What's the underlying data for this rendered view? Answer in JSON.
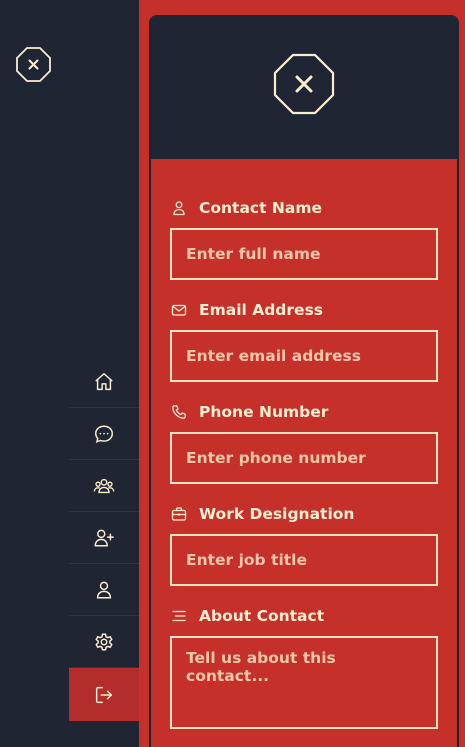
{
  "sidebar": {
    "logo_icon": "close-octagon-icon",
    "items": [
      {
        "name": "home",
        "icon": "home-icon"
      },
      {
        "name": "messages",
        "icon": "chat-bubble-icon"
      },
      {
        "name": "groups",
        "icon": "users-icon"
      },
      {
        "name": "add-user",
        "icon": "user-plus-icon"
      },
      {
        "name": "profile",
        "icon": "user-icon"
      },
      {
        "name": "settings",
        "icon": "gear-icon"
      },
      {
        "name": "logout",
        "icon": "logout-icon",
        "active": true
      }
    ]
  },
  "panel": {
    "close_icon": "close-octagon-icon"
  },
  "form": {
    "contact_name": {
      "label": "Contact Name",
      "placeholder": "Enter full name",
      "icon": "user-icon"
    },
    "email": {
      "label": "Email Address",
      "placeholder": "Enter email address",
      "icon": "mail-icon"
    },
    "phone": {
      "label": "Phone Number",
      "placeholder": "Enter phone number",
      "icon": "phone-icon"
    },
    "work": {
      "label": "Work Designation",
      "placeholder": "Enter job title",
      "icon": "briefcase-icon"
    },
    "about": {
      "label": "About Contact",
      "placeholder": "Tell us about this contact...",
      "icon": "align-icon"
    }
  },
  "colors": {
    "sidebar_bg": "#1f2532",
    "accent_red": "#c5302b",
    "active_red": "#b22d2c",
    "cream": "#fbeecf",
    "placeholder": "#f4c6a9"
  }
}
